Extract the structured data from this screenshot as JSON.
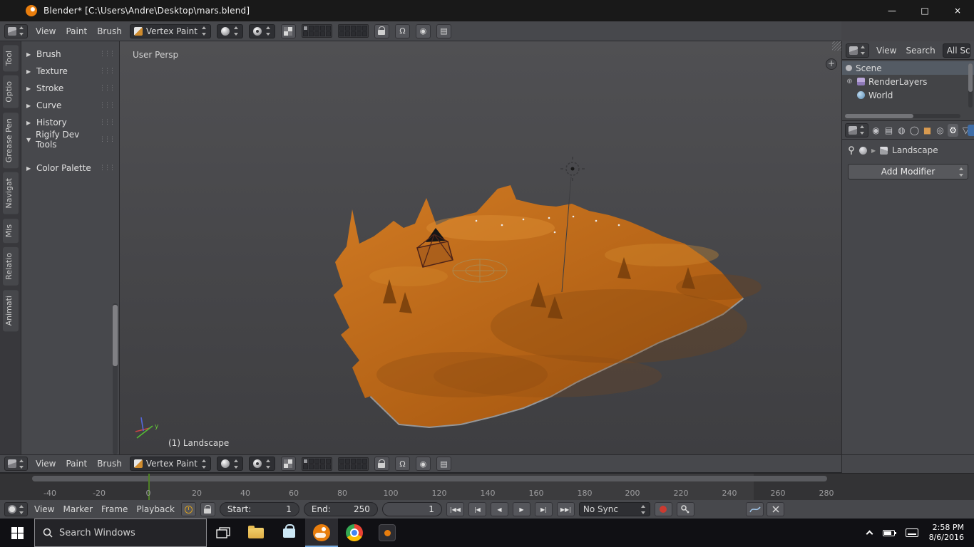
{
  "window": {
    "title": "Blender* [C:\\Users\\Andre\\Desktop\\mars.blend]",
    "minimize": "—",
    "maximize": "□",
    "close": "×"
  },
  "colors": {
    "terrain": "#c2661c",
    "blender_orange": "#e87d0d",
    "playhead_green": "#4f8026",
    "taskbar_active": "#76a9dd"
  },
  "view3d_header": {
    "menu_view": "View",
    "menu_paint": "Paint",
    "menu_brush": "Brush",
    "mode": "Vertex Paint"
  },
  "tool_tabs": {
    "t0": "Tool",
    "t1": "Optio",
    "t2": "Grease Pen",
    "t3": "Navigat",
    "t4": "Mis",
    "t5": "Relatio",
    "t6": "Animati"
  },
  "tool_shelf": {
    "grip": "⋮⋮⋮",
    "panels": [
      {
        "arrow": "▶",
        "label": "Brush"
      },
      {
        "arrow": "▶",
        "label": "Texture"
      },
      {
        "arrow": "▶",
        "label": "Stroke"
      },
      {
        "arrow": "▶",
        "label": "Curve"
      },
      {
        "arrow": "▶",
        "label": "History"
      },
      {
        "arrow": "▼",
        "label": "Rigify Dev Tools"
      },
      {
        "arrow": "▶",
        "label": "Color Palette"
      }
    ]
  },
  "viewport": {
    "view_label": "User Persp",
    "object_info": "(1) Landscape",
    "axis_y": "y",
    "add_region": "+"
  },
  "outliner": {
    "menu_view": "View",
    "menu_search": "Search",
    "filter": "All Sc",
    "expander": "⊕",
    "items": [
      {
        "label": "Scene"
      },
      {
        "label": "RenderLayers"
      },
      {
        "label": "World"
      }
    ]
  },
  "properties": {
    "crumb_arrow": "▶",
    "object_name": "Landscape",
    "add_modifier": "Add Modifier"
  },
  "icons": {
    "render": "◉",
    "render_layers": "▤",
    "scene": "◍",
    "world": "◯",
    "object": "■",
    "constraints": "◎",
    "modifiers": "⚙",
    "object_data": "▽",
    "snap": "Ω"
  },
  "timeline": {
    "menu_view": "View",
    "menu_marker": "Marker",
    "menu_frame": "Frame",
    "menu_playback": "Playback",
    "start_label": "Start:",
    "start_value": "1",
    "end_label": "End:",
    "end_value": "250",
    "frame": "1",
    "sync": "No Sync",
    "transport": [
      "|◀◀",
      "|◀",
      "◀",
      "▶",
      "▶|",
      "▶▶|"
    ],
    "ticks": [
      "-40",
      "-20",
      "0",
      "20",
      "40",
      "60",
      "80",
      "100",
      "120",
      "140",
      "160",
      "180",
      "200",
      "220",
      "240",
      "260",
      "280"
    ]
  },
  "taskbar": {
    "search_placeholder": "Search Windows",
    "time": "2:58 PM",
    "date": "8/6/2016"
  }
}
